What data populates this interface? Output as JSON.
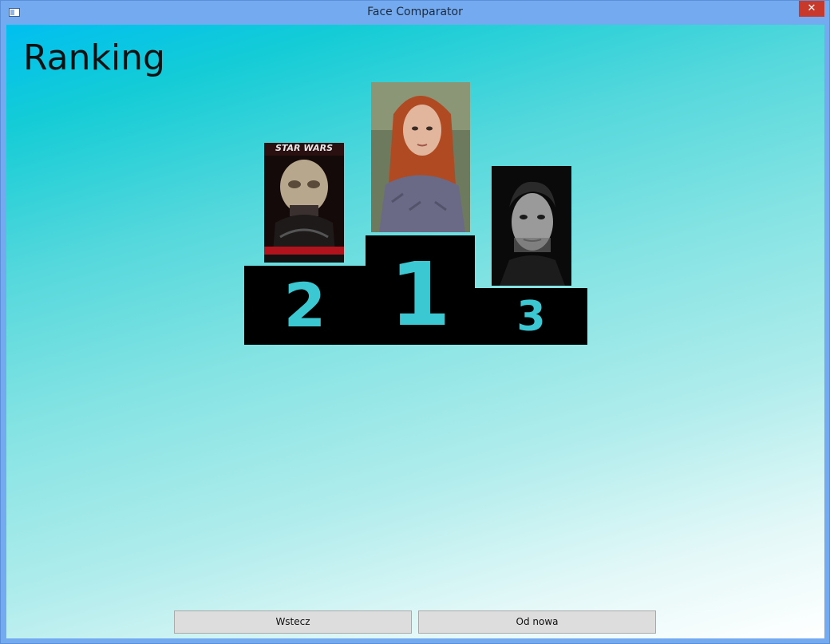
{
  "window": {
    "title": "Face Comparator",
    "close_glyph": "✕"
  },
  "page": {
    "heading": "Ranking"
  },
  "podium": {
    "first": {
      "label": "1"
    },
    "second": {
      "label": "2"
    },
    "third": {
      "label": "3"
    }
  },
  "photos": {
    "second_poster_text": "STAR WARS"
  },
  "buttons": {
    "back": "Wstecz",
    "restart": "Od nowa"
  }
}
